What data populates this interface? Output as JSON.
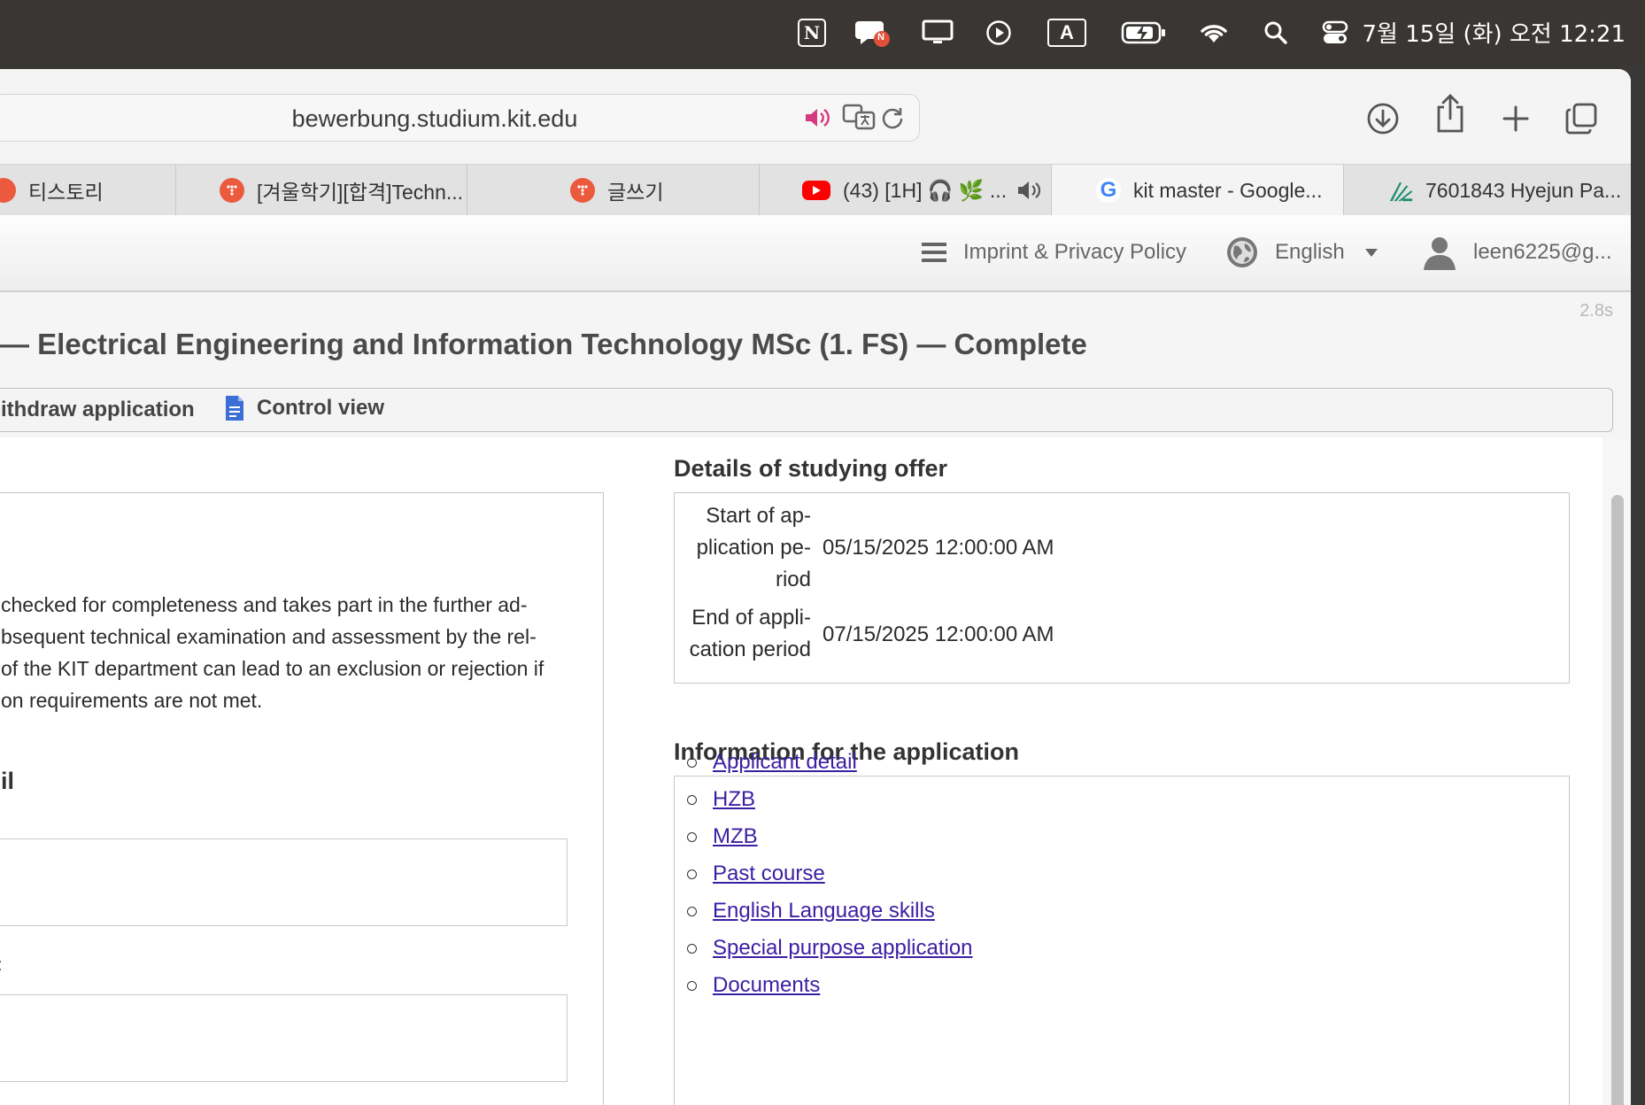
{
  "menubar": {
    "clock": "7월 15일 (화) 오전 12:21",
    "icons": [
      "notion-icon",
      "chat-notification-icon",
      "display-icon",
      "play-circle-icon",
      "input-source-icon",
      "battery-charging-icon",
      "wifi-icon",
      "search-icon",
      "control-center-icon"
    ],
    "input_source_label": "A",
    "notion_label": "N",
    "badge_label": "N"
  },
  "browser": {
    "url": "bewerbung.studium.kit.edu",
    "tabs": [
      {
        "title": "티스토리",
        "icon": "tistory-icon"
      },
      {
        "title": "[겨울학기][합격]Techn...",
        "icon": "tistory-icon"
      },
      {
        "title": "글쓰기",
        "icon": "tistory-icon"
      },
      {
        "title": "(43) [1H] 🎧 🌿 ...",
        "icon": "youtube-icon"
      },
      {
        "title": "kit master - Google...",
        "icon": "google-icon"
      },
      {
        "title": "7601843 Hyejun Pa...",
        "icon": "kit-icon"
      }
    ],
    "google_letter": "G"
  },
  "site": {
    "imprint": "Imprint & Privacy Policy",
    "language": "English",
    "user": "leen6225@g...",
    "timing": "2.8s"
  },
  "page": {
    "title": "— Electrical Engineering and Information Technology MSc (1. FS) — Complete",
    "actions": {
      "withdraw": "ithdraw application",
      "control": "Control view"
    },
    "left": {
      "paragraph_lines": [
        "checked for completeness and takes part in the further ad-",
        "bsequent technical examination and assessment by the rel-",
        "of the KIT department can lead to an exclusion or rejection if",
        "on requirements are not met."
      ],
      "partial_heading": "il",
      "partial_label": ":"
    },
    "offer": {
      "heading": "Details of studying offer",
      "start_label": "Start of ap-\nplication pe-\nriod",
      "start_value": "05/15/2025 12:00:00 AM",
      "end_label": "End of appli-\ncation period",
      "end_value": "07/15/2025 12:00:00 AM"
    },
    "info": {
      "heading": "Information for the application",
      "links": [
        "Applicant detail",
        "HZB",
        "MZB",
        "Past course",
        "English Language skills",
        "Special purpose application",
        "Documents"
      ]
    }
  }
}
